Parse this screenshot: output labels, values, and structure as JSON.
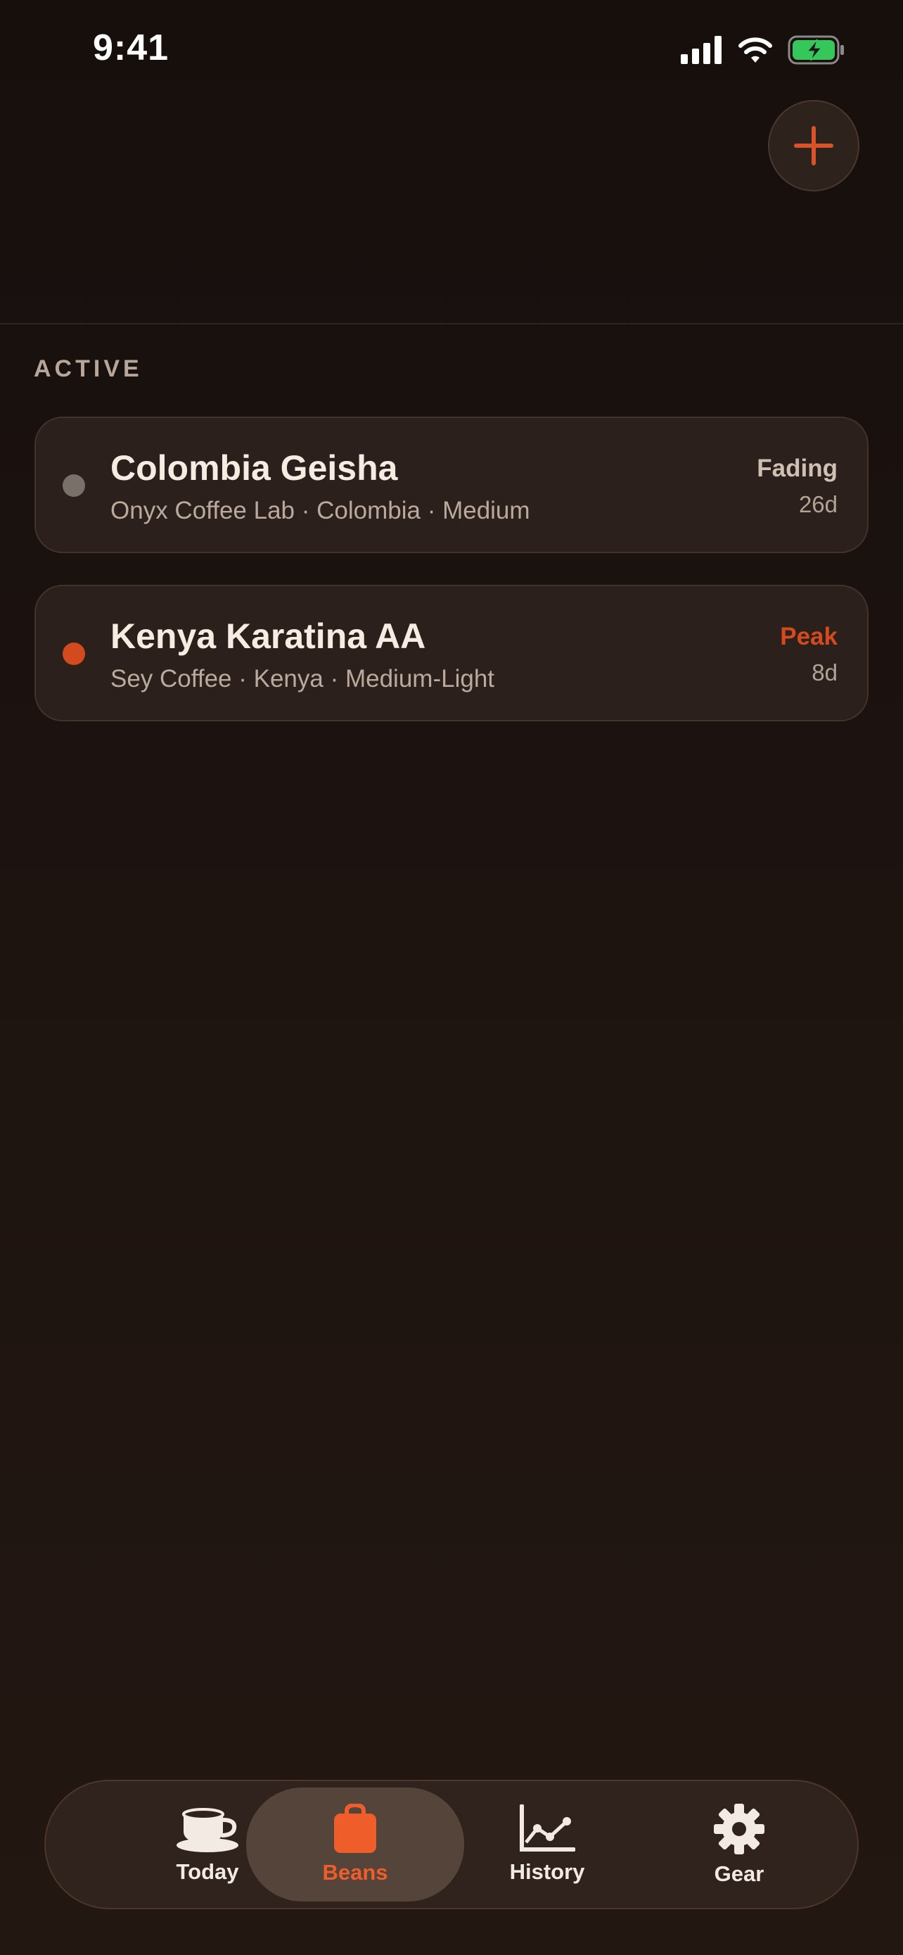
{
  "status_bar": {
    "time": "9:41",
    "battery_color": "#35c759",
    "icons": [
      "cellular-signal-icon",
      "wifi-icon",
      "battery-charging-icon"
    ]
  },
  "header": {
    "add_icon": "plus-icon",
    "accent": "#d9532a"
  },
  "section": {
    "title": "ACTIVE"
  },
  "beans": [
    {
      "name": "Colombia Geisha",
      "meta": "Onyx Coffee Lab · Colombia · Medium",
      "status": "Fading",
      "age": "26d",
      "status_color": "#cfc0b3",
      "dot_color": "#7a706a"
    },
    {
      "name": "Kenya Karatina AA",
      "meta": "Sey Coffee · Kenya · Medium-Light",
      "status": "Peak",
      "age": "8d",
      "status_color": "#d24a1e",
      "dot_color": "#d24a1e"
    }
  ],
  "tabs": [
    {
      "label": "Today",
      "icon": "coffee-cup-icon",
      "active": false
    },
    {
      "label": "Beans",
      "icon": "bag-icon",
      "active": true
    },
    {
      "label": "History",
      "icon": "chart-icon",
      "active": false
    },
    {
      "label": "Gear",
      "icon": "gear-icon",
      "active": false
    }
  ],
  "colors": {
    "active_tab": "#ef5d2a",
    "inactive_tab": "#f3ebe3"
  }
}
